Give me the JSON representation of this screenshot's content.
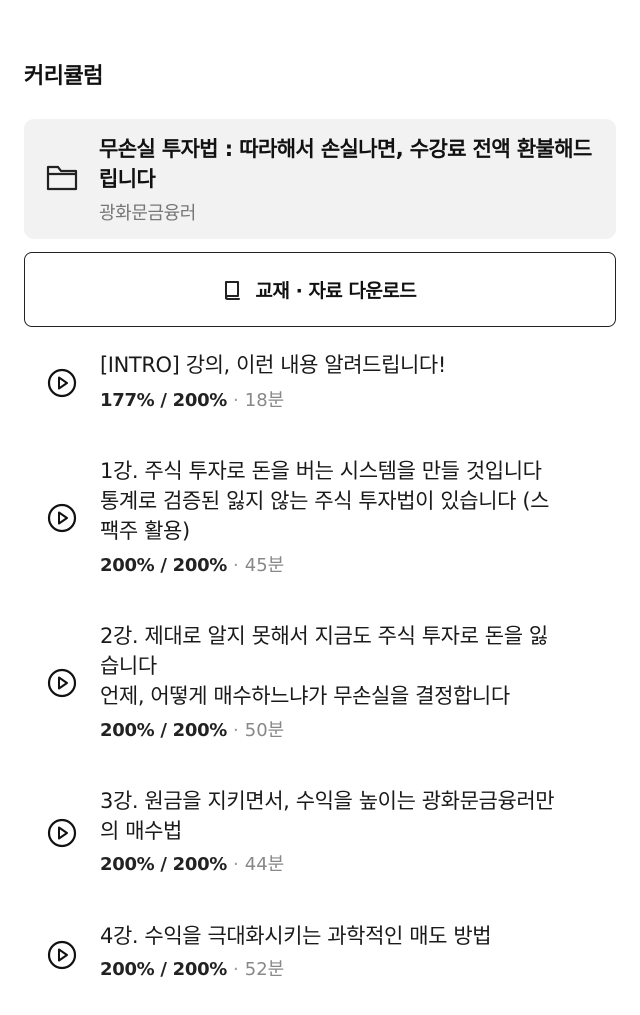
{
  "section": {
    "title": "커리큘럼"
  },
  "course": {
    "icon": "folder-icon",
    "title": "무손실 투자법 : 따라해서 손실나면, 수강료 전액 환불해드립니다",
    "author": "광화문금융러"
  },
  "download": {
    "icon": "book-icon",
    "label": "교재 · 자료 다운로드"
  },
  "lessons": [
    {
      "title": "[INTRO] 강의, 이런 내용 알려드립니다!",
      "progress": "177% / 200%",
      "separator": "·",
      "duration": "18분"
    },
    {
      "title": "1강. 주식 투자로 돈을 버는 시스템을 만들 것입니다\n통계로 검증된 잃지 않는 주식 투자법이 있습니다 (스\n팩주 활용)",
      "progress": "200% / 200%",
      "separator": "·",
      "duration": "45분"
    },
    {
      "title": "2강. 제대로 알지 못해서 지금도 주식 투자로 돈을 잃\n습니다\n언제, 어떻게 매수하느냐가 무손실을 결정합니다",
      "progress": "200% / 200%",
      "separator": "·",
      "duration": "50분"
    },
    {
      "title": "3강. 원금을 지키면서, 수익을 높이는 광화문금융러만\n의 매수법",
      "progress": "200% / 200%",
      "separator": "·",
      "duration": "44분"
    },
    {
      "title": "4강. 수익을 극대화시키는 과학적인 매도 방법",
      "progress": "200% / 200%",
      "separator": "·",
      "duration": "52분"
    }
  ]
}
